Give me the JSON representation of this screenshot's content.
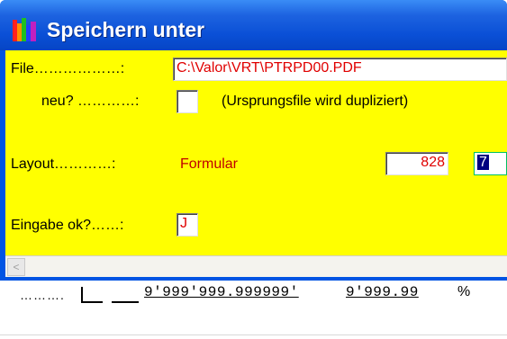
{
  "window": {
    "title": "Speichern unter"
  },
  "form": {
    "file_label": "File………………:",
    "file_value": "C:\\Valor\\VRT\\PTRPD00.PDF",
    "neu_label": "neu? …………:",
    "neu_note": "(Ursprungsfile wird dupliziert)",
    "layout_label": "Layout…………:",
    "layout_value": "Formular",
    "layout_number": "828",
    "layout_code": "7",
    "eingabe_label": "Eingabe ok?……:",
    "eingabe_value": "J"
  },
  "background": {
    "dots": "……….",
    "value1": "9'999'999.999999'",
    "value2": "9'999.99",
    "pct": "%"
  },
  "scrollbar": {
    "left_arrow": "<"
  }
}
